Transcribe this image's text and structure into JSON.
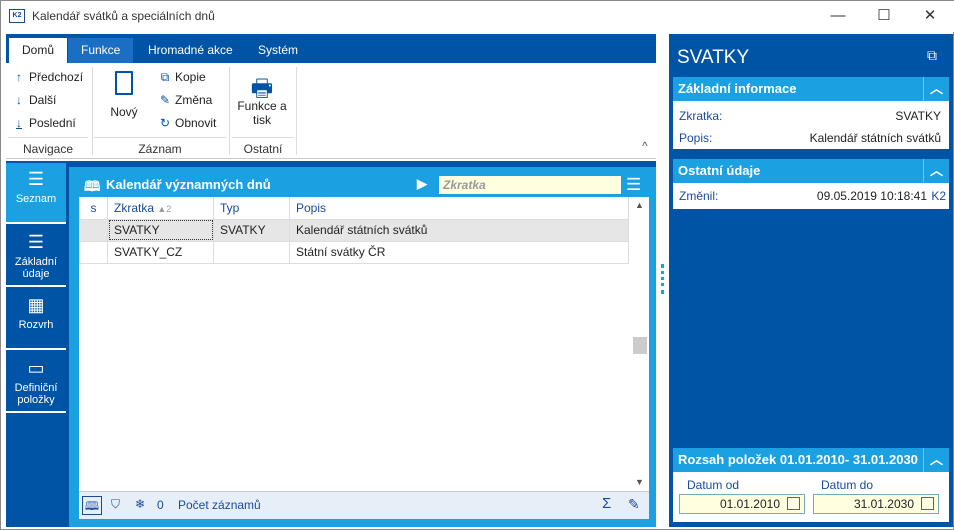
{
  "window": {
    "title": "Kalendář svátků a speciálních dnů",
    "logo": "K2",
    "minimize": "—",
    "maximize": "☐",
    "close": "✕"
  },
  "ribbon": {
    "tabs": [
      "Domů",
      "Funkce",
      "Hromadné akce",
      "Systém"
    ],
    "navigace": {
      "label": "Navigace",
      "items": [
        "Předchozí",
        "Další",
        "Poslední"
      ]
    },
    "zaznam": {
      "label": "Záznam",
      "new": "Nový",
      "items": [
        "Kopie",
        "Změna",
        "Obnovit"
      ]
    },
    "ostatni": {
      "label": "Ostatní",
      "print_line1": "Funkce a",
      "print_line2": "tisk"
    }
  },
  "nav": [
    {
      "label": "Seznam",
      "label2": ""
    },
    {
      "label": "Základní",
      "label2": "údaje"
    },
    {
      "label": "Rozvrh",
      "label2": ""
    },
    {
      "label": "Definiční",
      "label2": "položky"
    }
  ],
  "grid": {
    "title": "Kalendář významných dnů",
    "search_placeholder": "Zkratka",
    "columns": [
      "s",
      "Zkratka",
      "Typ",
      "Popis"
    ],
    "sort_index": "2",
    "rows": [
      {
        "s": "",
        "zkratka": "SVATKY",
        "typ": "SVATKY",
        "popis": "Kalendář státních svátků"
      },
      {
        "s": "",
        "zkratka": "SVATKY_CZ",
        "typ": "",
        "popis": "Státní svátky ČR"
      }
    ],
    "footer": {
      "count": "0",
      "count_label": "Počet záznamů"
    }
  },
  "detail": {
    "title": "SVATKY",
    "basic": {
      "header": "Základní informace",
      "zkratka_label": "Zkratka:",
      "zkratka": "SVATKY",
      "popis_label": "Popis:",
      "popis": "Kalendář státních svátků"
    },
    "other": {
      "header": "Ostatní údaje",
      "changed_label": "Změnil:",
      "changed": "09.05.2019 10:18:41",
      "changed_by": "K2"
    },
    "range": {
      "header": "Rozsah položek 01.01.2010- 31.01.2030",
      "from_label": "Datum od",
      "from": "01.01.2010",
      "to_label": "Datum do",
      "to": "31.01.2030"
    }
  }
}
